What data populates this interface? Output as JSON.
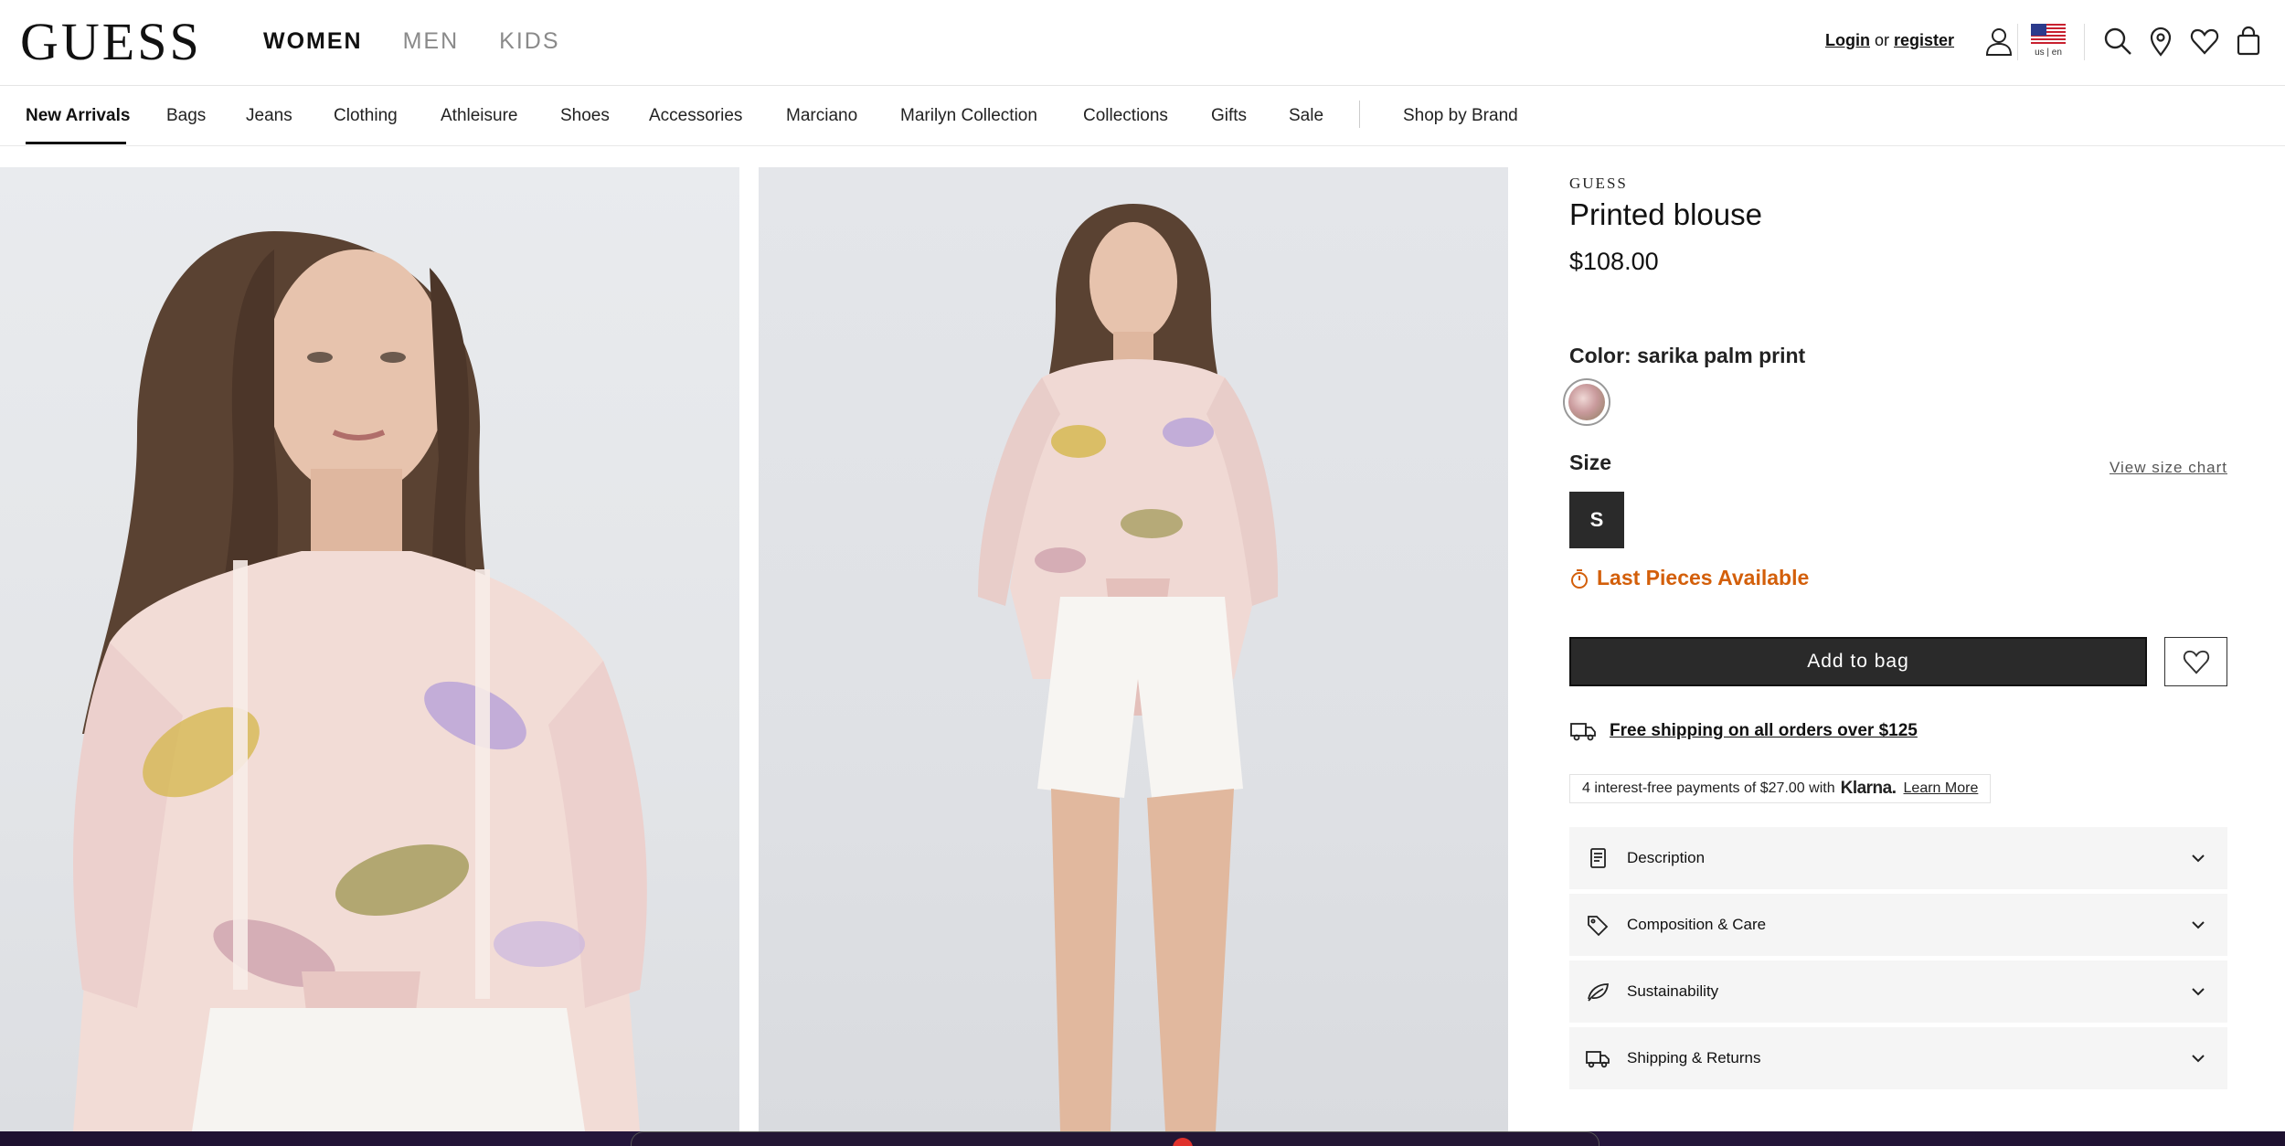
{
  "header": {
    "logo": "GUESS",
    "gender_tabs": [
      "WOMEN",
      "MEN",
      "KIDS"
    ],
    "active_gender": "WOMEN",
    "login_label": "Login",
    "or_label": "or",
    "register_label": "register",
    "locale_label": "us | en",
    "icons": [
      "account-icon",
      "us-flag-icon",
      "search-icon",
      "store-locator-icon",
      "wishlist-icon",
      "bag-icon"
    ]
  },
  "category_nav": {
    "items": [
      "New Arrivals",
      "Bags",
      "Jeans",
      "Clothing",
      "Athleisure",
      "Shoes",
      "Accessories",
      "Marciano",
      "Marilyn Collection",
      "Collections",
      "Gifts",
      "Sale"
    ],
    "active": "New Arrivals",
    "shop_by_brand": "Shop by Brand"
  },
  "product": {
    "brand": "GUESS",
    "name": "Printed blouse",
    "price": "$108.00",
    "color_label": "Color: sarika palm print",
    "size_label": "Size",
    "size_chart_link": "View size chart",
    "sizes": [
      "S"
    ],
    "selected_size": "S",
    "stock_status": "Last Pieces Available",
    "add_to_bag": "Add to bag",
    "shipping_text": "Free shipping on all orders over $125",
    "klarna": {
      "prefix": "4 interest-free payments of $27.00 with",
      "brand": "Klarna.",
      "link": "Learn More"
    },
    "accordions": [
      {
        "label": "Description",
        "icon": "document-icon"
      },
      {
        "label": "Composition & Care",
        "icon": "tag-icon"
      },
      {
        "label": "Sustainability",
        "icon": "leaf-icon"
      },
      {
        "label": "Shipping & Returns",
        "icon": "truck-icon"
      }
    ]
  },
  "colors": {
    "accent_dark": "#2a2a2a",
    "stock_orange": "#d35f0a",
    "accordion_bg": "#f5f5f5"
  }
}
